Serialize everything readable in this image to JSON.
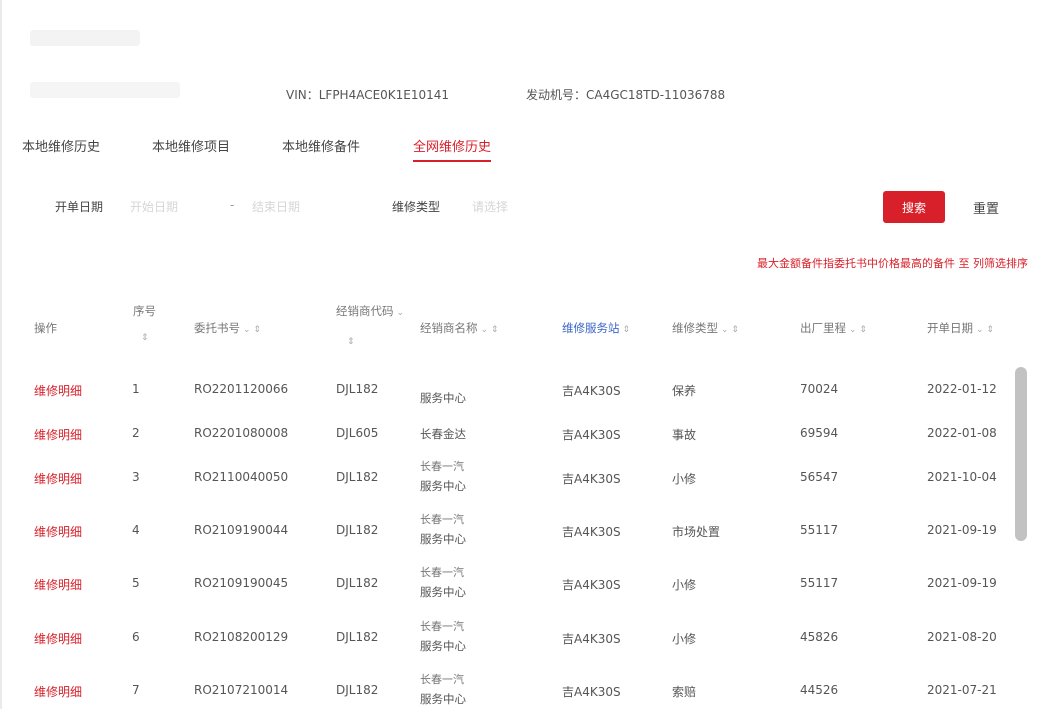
{
  "header": {
    "vin": "VIN：LFPH4ACE0K1E10141",
    "engine_no": "发动机号：CA4GC18TD-11036788"
  },
  "tabs": [
    "本地维修历史",
    "本地维修项目",
    "本地维修备件",
    "全网维修历史"
  ],
  "active_tab": 3,
  "filters": {
    "date_label": "开单日期",
    "start_placeholder": "开始日期",
    "separator": "-",
    "end_placeholder": "结束日期",
    "type_label": "维修类型",
    "type_placeholder": "请选择"
  },
  "buttons": {
    "search": "搜索",
    "reset": "重置"
  },
  "note": "最大金额备件指委托书中价格最高的备件   至 列筛选排序",
  "columns": [
    "操作",
    "序号",
    "委托书号",
    "经销商代码",
    "经销商名称",
    "维修服务站",
    "维修类型",
    "出厂里程",
    "开单日期"
  ],
  "rows": [
    {
      "action": "维修明细",
      "no": "1",
      "ro": "RO2201120066",
      "dealer_code": "DJL182",
      "dealer_line1": "",
      "dealer_line2": "服务中心",
      "station": "吉A4K30S",
      "type": "保养",
      "mileage": "70024",
      "date": "2022-01-12"
    },
    {
      "action": "维修明细",
      "no": "2",
      "ro": "RO2201080008",
      "dealer_code": "DJL605",
      "dealer_line1": "",
      "dealer_line2": "长春金达",
      "station": "吉A4K30S",
      "type": "事故",
      "mileage": "69594",
      "date": "2022-01-08"
    },
    {
      "action": "维修明细",
      "no": "3",
      "ro": "RO2110040050",
      "dealer_code": "DJL182",
      "dealer_line1": "长春一汽",
      "dealer_line2": "服务中心",
      "station": "吉A4K30S",
      "type": "小修",
      "mileage": "56547",
      "date": "2021-10-04"
    },
    {
      "action": "维修明细",
      "no": "4",
      "ro": "RO2109190044",
      "dealer_code": "DJL182",
      "dealer_line1": "长春一汽",
      "dealer_line2": "服务中心",
      "station": "吉A4K30S",
      "type": "市场处置",
      "mileage": "55117",
      "date": "2021-09-19"
    },
    {
      "action": "维修明细",
      "no": "5",
      "ro": "RO2109190045",
      "dealer_code": "DJL182",
      "dealer_line1": "长春一汽",
      "dealer_line2": "服务中心",
      "station": "吉A4K30S",
      "type": "小修",
      "mileage": "55117",
      "date": "2021-09-19"
    },
    {
      "action": "维修明细",
      "no": "6",
      "ro": "RO2108200129",
      "dealer_code": "DJL182",
      "dealer_line1": "长春一汽",
      "dealer_line2": "服务中心",
      "station": "吉A4K30S",
      "type": "小修",
      "mileage": "45826",
      "date": "2021-08-20"
    },
    {
      "action": "维修明细",
      "no": "7",
      "ro": "RO2107210014",
      "dealer_code": "DJL182",
      "dealer_line1": "长春一汽",
      "dealer_line2": "服务中心",
      "station": "吉A4K30S",
      "type": "索赔",
      "mileage": "44526",
      "date": "2021-07-21"
    }
  ],
  "colors": {
    "accent": "#d8202a",
    "link_blue": "#3b64c8"
  }
}
